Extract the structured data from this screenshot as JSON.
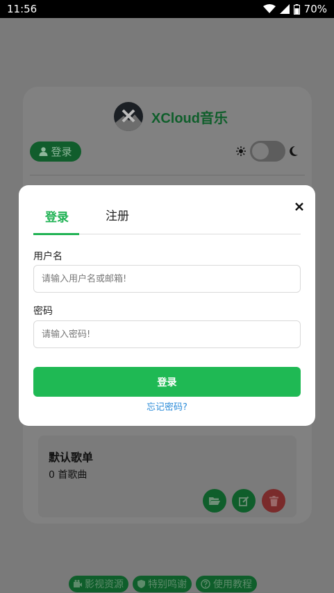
{
  "status_bar": {
    "time": "11:56",
    "battery": "70%"
  },
  "app": {
    "title": "XCloud音乐"
  },
  "header": {
    "login_label": "登录"
  },
  "playlist": {
    "name": "默认歌单",
    "count": "0 首歌曲"
  },
  "footer": {
    "links": [
      "影视资源",
      "特别鸣谢",
      "使用教程"
    ]
  },
  "modal": {
    "tabs": [
      "登录",
      "注册"
    ],
    "username": {
      "label": "用户名",
      "placeholder": "请输入用户名或邮箱!"
    },
    "password": {
      "label": "密码",
      "placeholder": "请输入密码!"
    },
    "submit_label": "登录",
    "forgot_label": "忘记密码?"
  },
  "colors": {
    "accent": "#1fb954",
    "link": "#2a8bd8",
    "overlay": "#7a7a7a"
  }
}
